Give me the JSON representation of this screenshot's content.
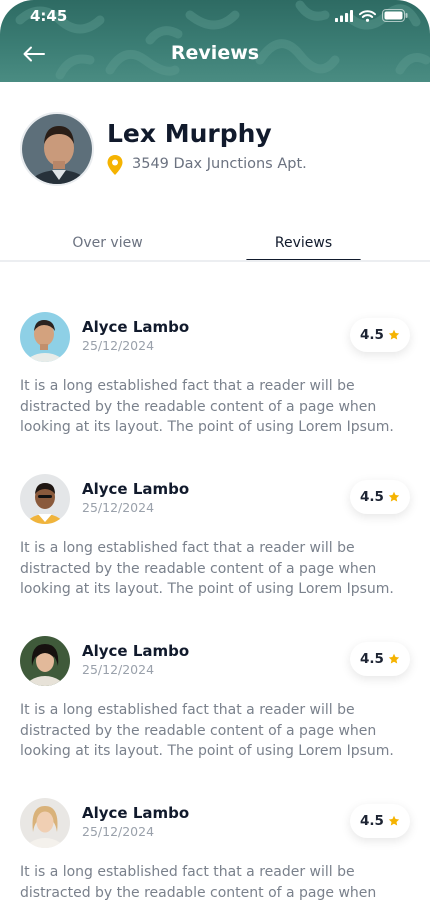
{
  "status_bar": {
    "time": "4:45"
  },
  "header": {
    "title": "Reviews",
    "back_icon": "arrow-left-icon",
    "background": "#3b7d74"
  },
  "profile": {
    "name": "Lex Murphy",
    "address": "3549 Dax Junctions Apt.",
    "location_icon": "map-pin-icon",
    "accent": "#f5b301"
  },
  "tabs": [
    {
      "label": "Over view",
      "active": false
    },
    {
      "label": "Reviews",
      "active": true
    }
  ],
  "reviews": [
    {
      "name": "Alyce Lambo",
      "date": "25/12/2024",
      "rating": "4.5",
      "text": "It is a long established fact that a reader will be distracted by the readable content of a page when looking at its layout. The point of using Lorem Ipsum."
    },
    {
      "name": "Alyce Lambo",
      "date": "25/12/2024",
      "rating": "4.5",
      "text": "It is a long established fact that a reader will be distracted by the readable content of a page when looking at its layout. The point of using Lorem Ipsum."
    },
    {
      "name": "Alyce Lambo",
      "date": "25/12/2024",
      "rating": "4.5",
      "text": "It is a long established fact that a reader will be distracted by the readable content of a page when looking at its layout. The point of using Lorem Ipsum."
    },
    {
      "name": "Alyce Lambo",
      "date": "25/12/2024",
      "rating": "4.5",
      "text": "It is a long established fact that a reader will be distracted by the readable content of a page when looking at its"
    }
  ],
  "colors": {
    "star": "#f5b301",
    "text_primary": "#111a2c",
    "text_secondary": "#7a818c"
  }
}
